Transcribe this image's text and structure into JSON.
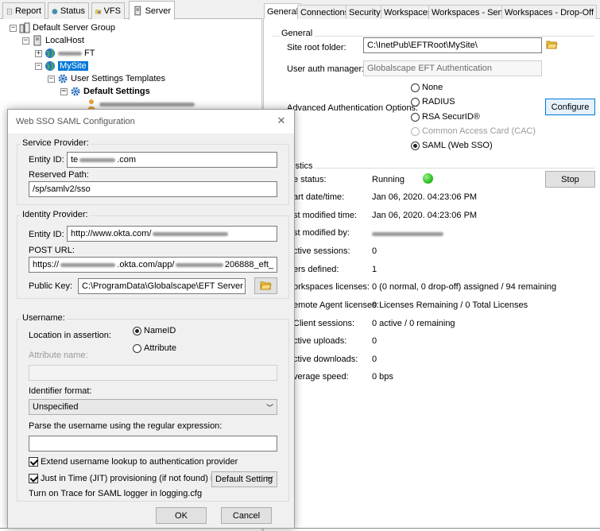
{
  "left_tabs": [
    {
      "label": "Report"
    },
    {
      "label": "Status"
    },
    {
      "label": "VFS"
    },
    {
      "label": "Server"
    }
  ],
  "tree": {
    "root": "Default Server Group",
    "localhost": "LocalHost",
    "site1_suffix": "FT",
    "site2": "MySite",
    "templates": "User Settings Templates",
    "default_settings": "Default Settings"
  },
  "right_tabs": [
    {
      "label": "General"
    },
    {
      "label": "Connections"
    },
    {
      "label": "Security"
    },
    {
      "label": "Workspaces"
    },
    {
      "label": "Workspaces - Send"
    },
    {
      "label": "Workspaces - Drop-Off"
    }
  ],
  "general": {
    "group_title": "General",
    "site_root_label": "Site root folder:",
    "site_root_value": "C:\\InetPub\\EFTRoot\\MySite\\",
    "user_auth_label": "User auth manager:",
    "user_auth_value": "Globalscape EFT Authentication",
    "adv_auth_label": "Advanced Authentication Options:",
    "adv_options": [
      {
        "label": "None",
        "selected": false,
        "disabled": false
      },
      {
        "label": "RADIUS",
        "selected": false,
        "disabled": false
      },
      {
        "label": "RSA SecurID®",
        "selected": false,
        "disabled": false
      },
      {
        "label": "Common Access Card (CAC)",
        "selected": false,
        "disabled": true
      },
      {
        "label": "SAML (Web SSO)",
        "selected": true,
        "disabled": false
      }
    ],
    "configure_button": "Configure"
  },
  "stats": {
    "group_title_partial": "istics",
    "stop_button": "Stop",
    "status_color": "#2fbf1f",
    "rows": [
      {
        "label": "e status:",
        "value": "Running"
      },
      {
        "label": "art date/time:",
        "value": "Jan 06, 2020. 04:23:06 PM"
      },
      {
        "label": "st modified time:",
        "value": "Jan 06, 2020. 04:23:06 PM"
      },
      {
        "label": "st modified by:",
        "value": ""
      },
      {
        "label": "ctive sessions:",
        "value": "0"
      },
      {
        "label": "ers defined:",
        "value": "1"
      },
      {
        "label": "orkspaces licenses:",
        "value": "0 (0 normal, 0 drop-off) assigned / 94 remaining"
      },
      {
        "label": "emote Agent licenses:",
        "value": "0 Licenses Remaining / 0 Total Licenses"
      },
      {
        "label": "Client sessions:",
        "value": "0 active / 0 remaining"
      },
      {
        "label": "ctive uploads:",
        "value": "0"
      },
      {
        "label": "ctive downloads:",
        "value": "0"
      },
      {
        "label": "verage speed:",
        "value": "0 bps"
      }
    ]
  },
  "dialog": {
    "title": "Web SSO SAML Configuration",
    "service_provider": {
      "title": "Service Provider:",
      "entity_id_label": "Entity ID:",
      "entity_id_prefix": "te",
      "entity_id_suffix": ".com",
      "reserved_path_label": "Reserved Path:",
      "reserved_path_value": "/sp/samlv2/sso"
    },
    "identity_provider": {
      "title": "Identity Provider:",
      "entity_id_label": "Entity ID:",
      "entity_id_value": "http://www.okta.com/",
      "post_url_label": "POST URL:",
      "post_url_part1": "https://",
      "post_url_part2": ".okta.com/app/",
      "post_url_part3": "206888_eft_",
      "public_key_label": "Public Key:",
      "public_key_value": "C:\\ProgramData\\Globalscape\\EFT Server Enterpr"
    },
    "username": {
      "title": "Username:",
      "location_label": "Location in assertion:",
      "nameid_label": "NameID",
      "attribute_label": "Attribute",
      "attribute_name_label": "Attribute name:",
      "identifier_format_label": "Identifier format:",
      "identifier_format_value": "Unspecified",
      "regex_label": "Parse the username using the regular expression:",
      "extend_lookup_label": "Extend username lookup to authentication provider",
      "jit_label": "Just in Time (JIT) provisioning (if not found) into:",
      "jit_value": "Default Setting",
      "trace_note": "Turn on Trace for SAML logger in logging.cfg"
    },
    "ok_button": "OK",
    "cancel_button": "Cancel"
  }
}
